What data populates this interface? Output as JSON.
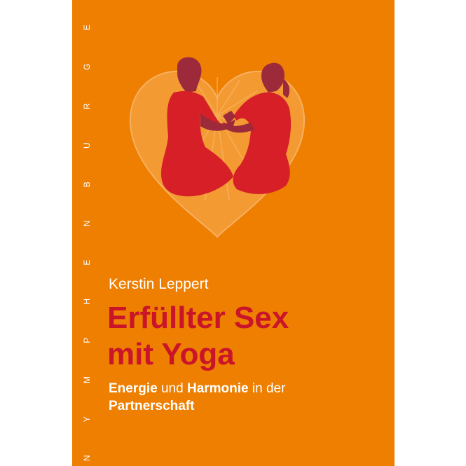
{
  "spine": {
    "publisher": "N Y M P H E N B U R G E R"
  },
  "cover": {
    "author": "Kerstin Leppert",
    "title_line1": "Erfüllter Sex",
    "title_line2": "mit Yoga",
    "subtitle": {
      "part1_bold": "Energie",
      "part2": " und ",
      "part3_bold": "Harmonie",
      "part4": " in der",
      "part5_bold": "Partnerschaft"
    }
  },
  "colors": {
    "background": "#ee7f00",
    "title": "#c9142a",
    "figures_body": "#d61f26",
    "figures_head": "#9d2a3a",
    "heart": "#f7a03a"
  }
}
